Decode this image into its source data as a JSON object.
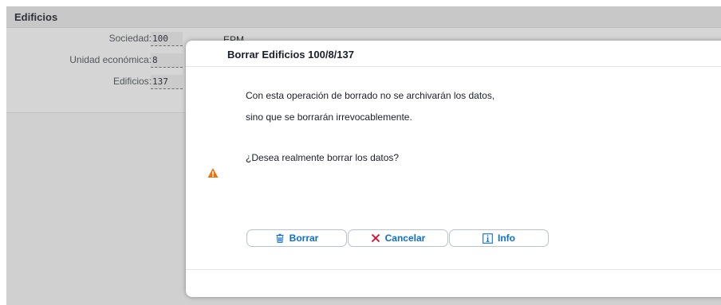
{
  "page": {
    "title": "Edificios"
  },
  "form": {
    "fields": [
      {
        "label": "Sociedad:",
        "value": "100"
      },
      {
        "label": "Unidad económica:",
        "value": "8"
      },
      {
        "label": "Edificios:",
        "value": "137"
      }
    ],
    "description": "EPM"
  },
  "dialog": {
    "title": "Borrar Edificios 100/8/137",
    "message_lines": [
      "Con esta operación de borrado no se archivarán los datos,",
      "sino que se borrarán irrevocablemente."
    ],
    "question": "¿Desea realmente borrar los datos?",
    "icon": "warning-icon",
    "buttons": {
      "delete": {
        "label": "Borrar",
        "icon": "trash-icon"
      },
      "cancel": {
        "label": "Cancelar",
        "icon": "close-icon"
      },
      "info": {
        "label": "Info",
        "icon": "info-icon"
      }
    }
  },
  "colors": {
    "accent": "#0a6ed1",
    "cancel": "#e0002a",
    "warning": "#e9730c"
  }
}
